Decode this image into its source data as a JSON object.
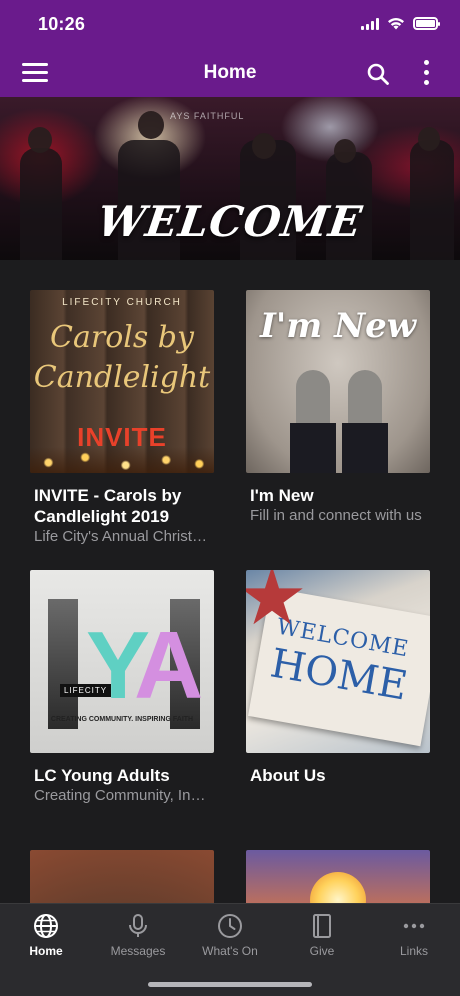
{
  "status": {
    "time": "10:26"
  },
  "header": {
    "title": "Home"
  },
  "hero": {
    "text": "WELCOME",
    "backdrop_text": "AYS FAITHFUL"
  },
  "cards": [
    {
      "title": "INVITE - Carols by Candlelight 2019",
      "subtitle": "Life City's Annual Christmas Carols",
      "image": {
        "top_text": "LIFECITY CHURCH",
        "script_line1": "Carols by",
        "script_line2": "Candlelight",
        "bottom_text": "INVITE"
      }
    },
    {
      "title": "I'm New",
      "subtitle": "Fill in and connect with us",
      "image": {
        "overlay_text": "I'm New"
      }
    },
    {
      "title": "LC Young Adults",
      "subtitle": "Creating Community, Inspiring Faith",
      "image": {
        "letters_1": "Y",
        "letters_2": "A",
        "badge": "LIFECITY",
        "tagline": "CREATING COMMUNITY. INSPIRING FAITH"
      }
    },
    {
      "title": "About Us",
      "subtitle": "",
      "image": {
        "line1": "WELCOME",
        "line2": "HOME"
      }
    }
  ],
  "tabbar": {
    "items": [
      {
        "label": "Home",
        "icon": "globe-icon",
        "active": true
      },
      {
        "label": "Messages",
        "icon": "microphone-icon",
        "active": false
      },
      {
        "label": "What's On",
        "icon": "clock-icon",
        "active": false
      },
      {
        "label": "Give",
        "icon": "book-icon",
        "active": false
      },
      {
        "label": "Links",
        "icon": "more-horizontal-icon",
        "active": false
      }
    ]
  },
  "colors": {
    "header_bg": "#6a1b8c",
    "page_bg": "#1c1c1e",
    "tabbar_bg": "#2b2b2e",
    "active_tab": "#ffffff",
    "inactive_tab": "#9a9a9e"
  }
}
